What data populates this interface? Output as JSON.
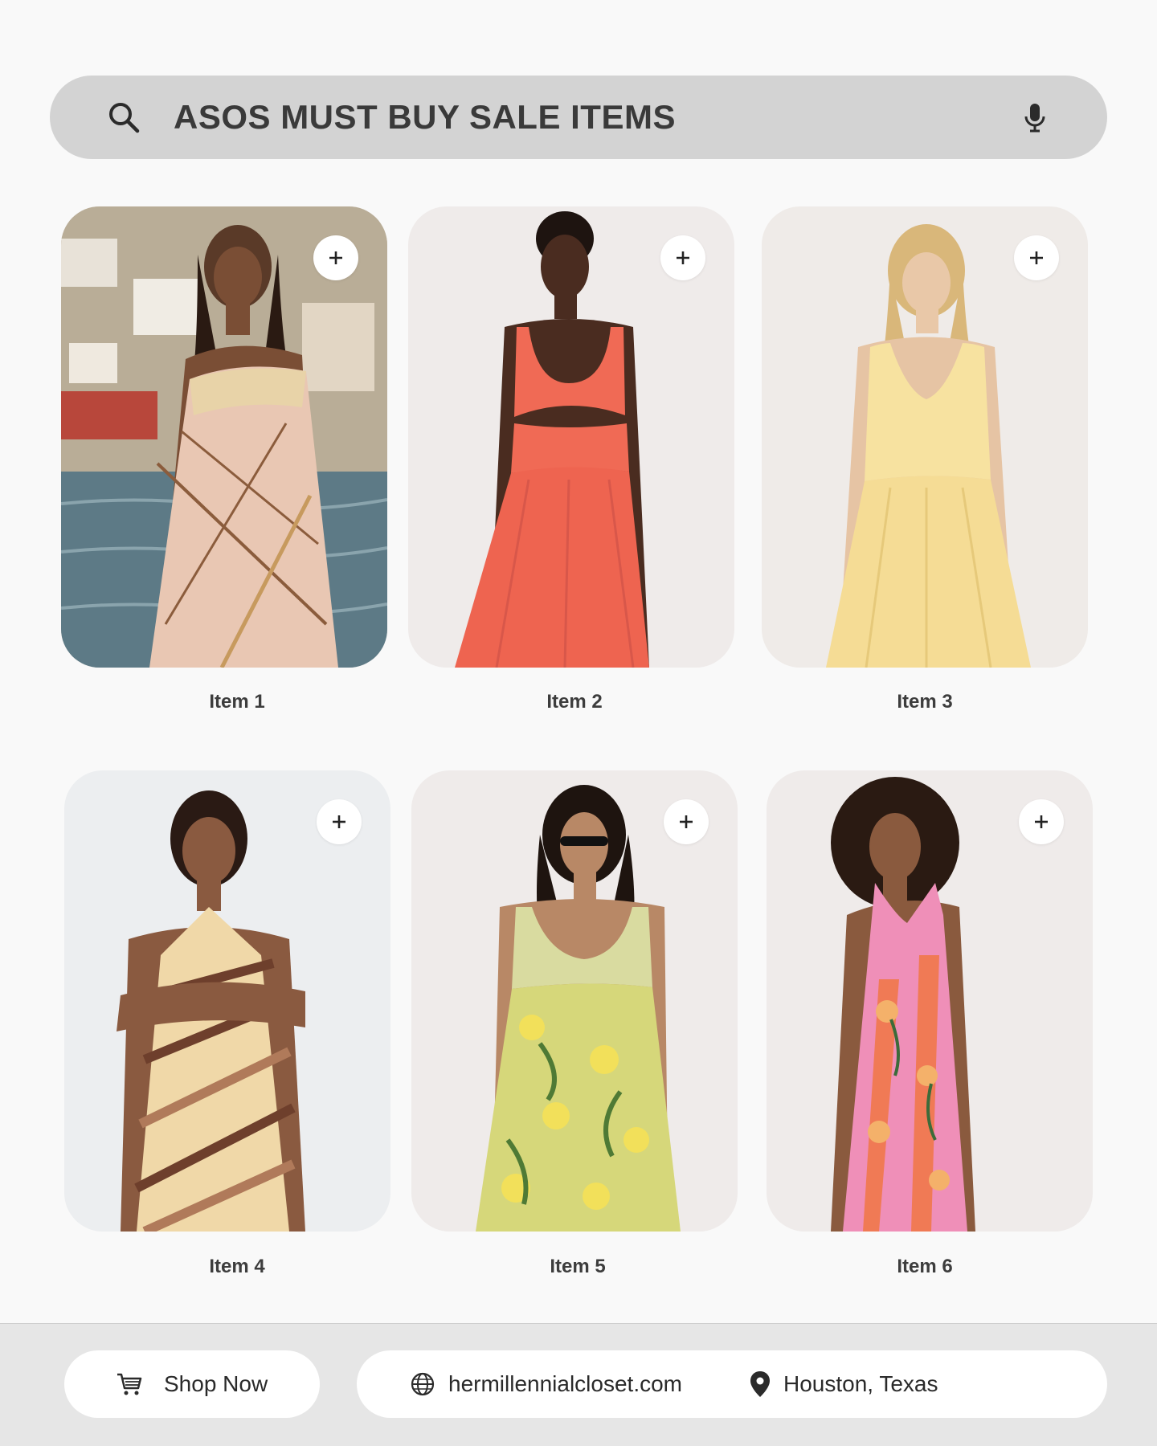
{
  "search": {
    "query": "ASOS MUST BUY SALE ITEMS",
    "search_icon": "search-icon",
    "mic_icon": "microphone-icon"
  },
  "products": [
    {
      "caption": "Item 1",
      "dress": "plaid slip dress with lace trim",
      "dress_color": "#e9c7b3",
      "add_icon": "plus-icon"
    },
    {
      "caption": "Item 2",
      "dress": "coral cut-out tank midi dress",
      "dress_color": "#f06a55",
      "add_icon": "plus-icon"
    },
    {
      "caption": "Item 3",
      "dress": "pale yellow v-neck sundress",
      "dress_color": "#f7e2a0",
      "add_icon": "plus-icon"
    },
    {
      "caption": "Item 4",
      "dress": "striped halter neck dress",
      "dress_color": "#b07a5a",
      "add_icon": "plus-icon"
    },
    {
      "caption": "Item 5",
      "dress": "yellow-green floral smocked dress",
      "dress_color": "#d6d77a",
      "add_icon": "plus-icon"
    },
    {
      "caption": "Item 6",
      "dress": "pink and orange floral maxi dress",
      "dress_color": "#ef8fb8",
      "add_icon": "plus-icon"
    }
  ],
  "footer": {
    "shop_label": "Shop Now",
    "shop_icon": "shopping-cart-icon",
    "website": "hermillennialcloset.com",
    "website_icon": "globe-icon",
    "location": "Houston, Texas",
    "location_icon": "map-pin-icon"
  },
  "colors": {
    "page_bg": "#f9f9f9",
    "search_bg": "#d3d3d3",
    "footer_bg": "#e6e6e6",
    "pill_bg": "#ffffff",
    "text": "#3a3a3a"
  }
}
